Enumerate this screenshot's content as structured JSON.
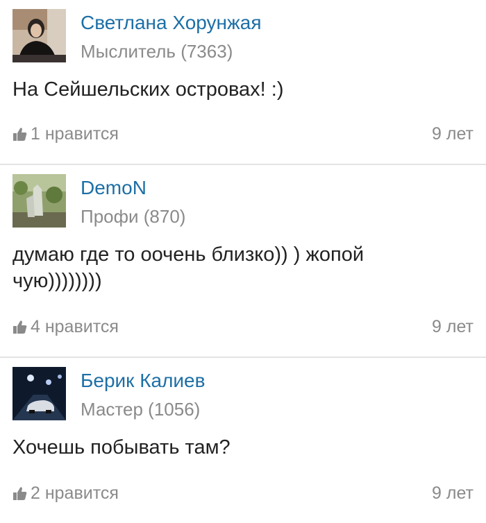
{
  "answers": [
    {
      "author": "Светлана Хорунжая",
      "rank": "Мыслитель (7363)",
      "text": "На Сейшельских островах! :)",
      "likes": "1 нравится",
      "age": "9 лет"
    },
    {
      "author": "DemoN",
      "rank": "Профи (870)",
      "text": "думаю где то оочень близко)) ) жопой чую))))))))",
      "likes": "4 нравится",
      "age": "9 лет"
    },
    {
      "author": "Берик Калиев",
      "rank": "Мастер (1056)",
      "text": "Хочешь побывать там?",
      "likes": "2 нравится",
      "age": "9 лет"
    }
  ],
  "icons": {
    "like": "thumbs-up-icon"
  },
  "colors": {
    "author": "#1d6fa6",
    "meta": "#8a8a8a",
    "text": "#222222",
    "divider": "#e3e3e3"
  }
}
